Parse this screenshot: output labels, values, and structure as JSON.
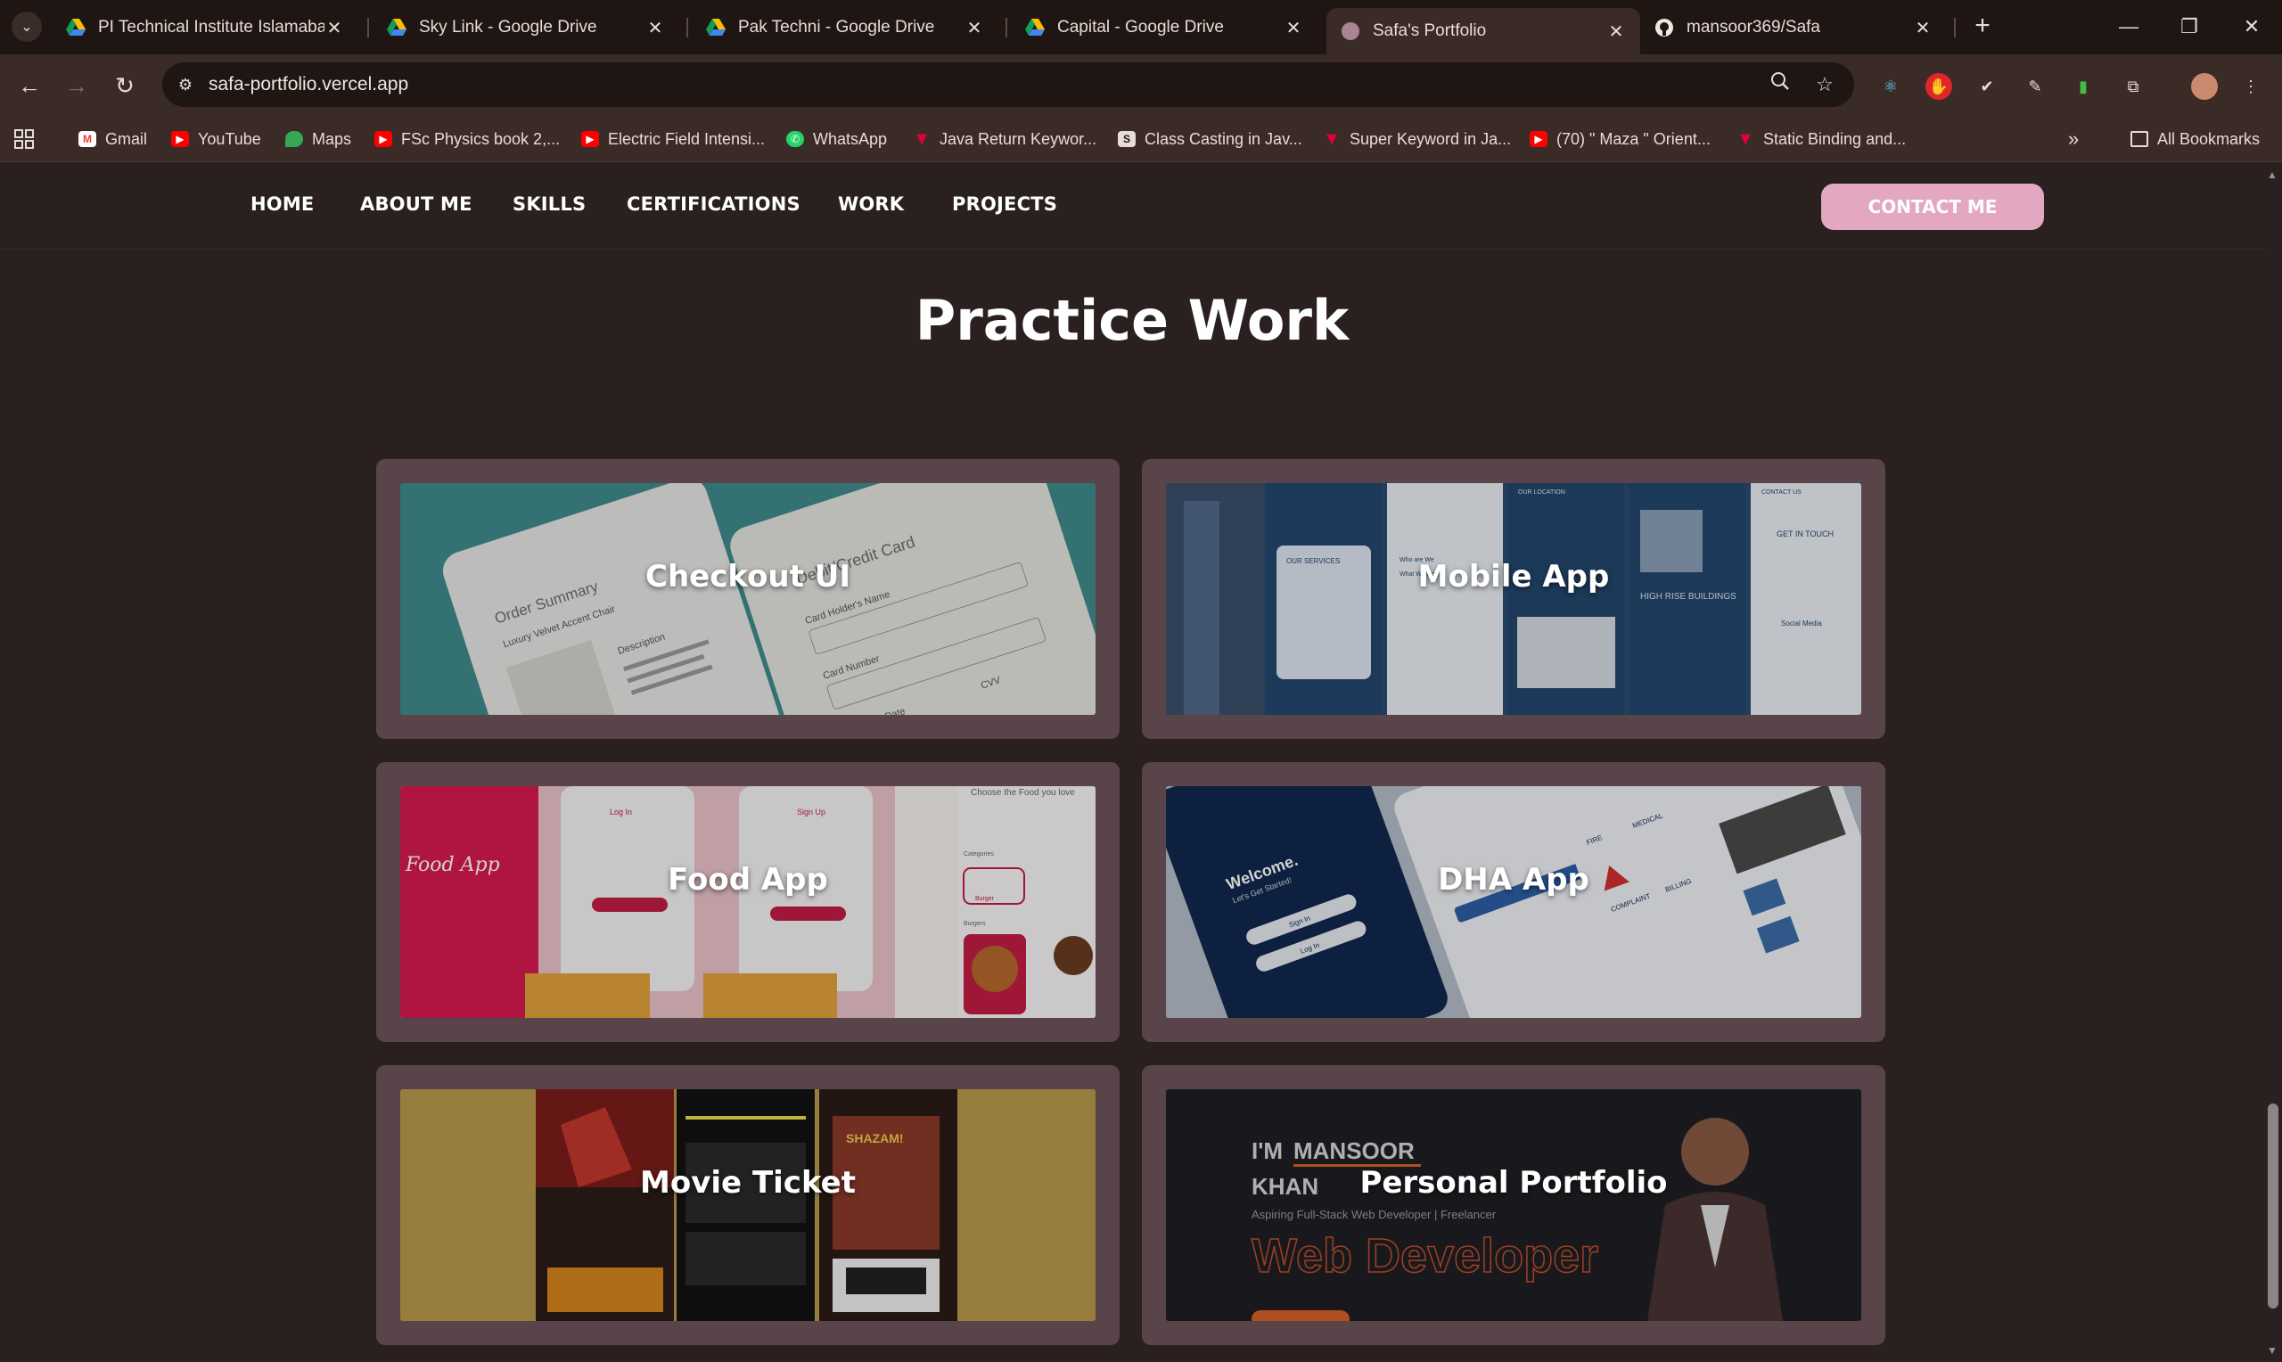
{
  "browser": {
    "tabs": [
      {
        "title": "PI Technical Institute Islamabad",
        "favicon": "google-drive-icon"
      },
      {
        "title": "Sky Link - Google Drive",
        "favicon": "google-drive-icon"
      },
      {
        "title": "Pak Techni - Google Drive",
        "favicon": "google-drive-icon"
      },
      {
        "title": "Capital - Google Drive",
        "favicon": "google-drive-icon"
      },
      {
        "title": "Safa's Portfolio",
        "favicon": "portfolio-icon",
        "active": true
      },
      {
        "title": "mansoor369/Safa",
        "favicon": "github-icon"
      }
    ],
    "url": "safa-portfolio.vercel.app",
    "bookmarks": [
      {
        "label": "Gmail",
        "icon": "gmail-icon"
      },
      {
        "label": "YouTube",
        "icon": "youtube-icon"
      },
      {
        "label": "Maps",
        "icon": "maps-icon"
      },
      {
        "label": "FSc Physics book 2,...",
        "icon": "youtube-icon"
      },
      {
        "label": "Electric Field Intensi...",
        "icon": "youtube-icon"
      },
      {
        "label": "WhatsApp",
        "icon": "whatsapp-icon"
      },
      {
        "label": "Java Return Keywor...",
        "icon": "javatpoint-icon"
      },
      {
        "label": "Class Casting in Jav...",
        "icon": "code-icon"
      },
      {
        "label": "Super Keyword in Ja...",
        "icon": "javatpoint-icon"
      },
      {
        "label": "(70) \" Maza \" Orient...",
        "icon": "youtube-icon"
      },
      {
        "label": "Static Binding and...",
        "icon": "javatpoint-icon"
      }
    ],
    "all_bookmarks": "All Bookmarks",
    "colors": {
      "tabbar": "#1f1513",
      "toolbar": "#3a2b27"
    }
  },
  "site": {
    "nav": [
      "HOME",
      "ABOUT ME",
      "SKILLS",
      "CERTIFICATIONS",
      "WORK",
      "PROJECTS"
    ],
    "contact_label": "CONTACT ME",
    "heading": "Practice Work",
    "projects": [
      {
        "title": "Checkout UI"
      },
      {
        "title": "Mobile App"
      },
      {
        "title": "Food App"
      },
      {
        "title": "DHA App"
      },
      {
        "title": "Movie Ticket"
      },
      {
        "title": "Personal Portfolio"
      }
    ],
    "thumb_text": {
      "checkout": {
        "order": "Order Summary",
        "item": "Luxury Velvet Accent Chair",
        "desc": "Description",
        "card": "Debit/Credit Card",
        "holder": "Card Holder's Name",
        "number": "Card Number",
        "expiry": "Expiration Date",
        "cvv": "CVV"
      },
      "mobile": {
        "services": "OUR SERVICES",
        "location": "OUR LOCATION",
        "highrise": "HIGH RISE BUILDINGS",
        "contact": "CONTACT US",
        "touch": "GET IN TOUCH",
        "social": "Social Media",
        "who": "Who are We",
        "what": "What We Do"
      },
      "food": {
        "logo": "Food App",
        "login": "Log In",
        "signup": "Sign Up",
        "choose": "Choose the Food you love",
        "categories": "Categories",
        "burger": "Burger",
        "burgers": "Burgers"
      },
      "dha": {
        "welcome": "Welcome.",
        "started": "Let's Get Started!",
        "signin": "Sign In",
        "login": "Log In",
        "complaint": "COMPLAINT",
        "billing": "BILLING",
        "medical": "MEDICAL",
        "fire": "FIRE"
      },
      "movie": {
        "badge": "SHAZAM!"
      },
      "portfolio": {
        "im": "I'M",
        "first": "MANSOOR",
        "last": "KHAN",
        "tagline": "Aspiring Full-Stack Web Developer | Freelancer",
        "role": "Web Developer"
      }
    },
    "colors": {
      "background": "#2a2020",
      "card": "#584449",
      "contact_button": "#e3a7c2"
    }
  }
}
